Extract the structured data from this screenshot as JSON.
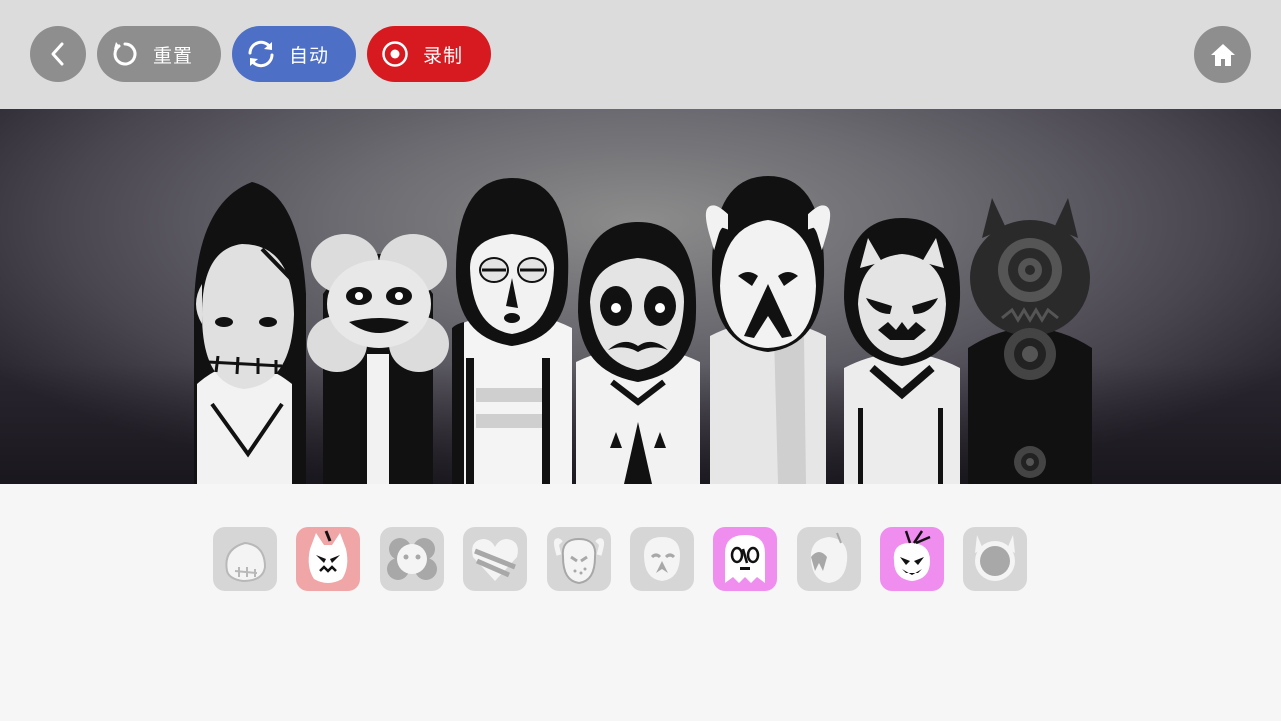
{
  "toolbar": {
    "back_icon": "chevron-left-icon",
    "reset_label": "重置",
    "reset_icon": "rotate-icon",
    "auto_label": "自动",
    "auto_icon": "sync-icon",
    "record_label": "录制",
    "record_icon": "record-icon",
    "home_icon": "home-icon"
  },
  "stage": {
    "characters": [
      "stitched-girl",
      "flower-face",
      "closed-eyes-boy",
      "mustache-face",
      "sad-goat",
      "cat-mask",
      "target-demon"
    ]
  },
  "tray": {
    "slots": [
      {
        "icon": "stitched-face-icon",
        "active": false
      },
      {
        "icon": "cat-face-icon",
        "active": true,
        "color": "#f0a6a6"
      },
      {
        "icon": "flower-icon",
        "active": false
      },
      {
        "icon": "heart-stripe-icon",
        "active": false
      },
      {
        "icon": "goat-face-icon",
        "active": false
      },
      {
        "icon": "sad-face-icon",
        "active": false
      },
      {
        "icon": "glasses-ghost-icon",
        "active": true,
        "color": "#f08ef0"
      },
      {
        "icon": "drip-head-icon",
        "active": false
      },
      {
        "icon": "angry-fruit-icon",
        "active": true,
        "color": "#f08ef0"
      },
      {
        "icon": "horned-circle-icon",
        "active": false
      }
    ]
  },
  "colors": {
    "topbar": "#dcdcdc",
    "button_gray": "#8e8e8e",
    "auto_blue": "#4e6fc6",
    "record_red": "#d71920",
    "active_pink": "#f0a6a6",
    "active_magenta": "#f08ef0"
  }
}
